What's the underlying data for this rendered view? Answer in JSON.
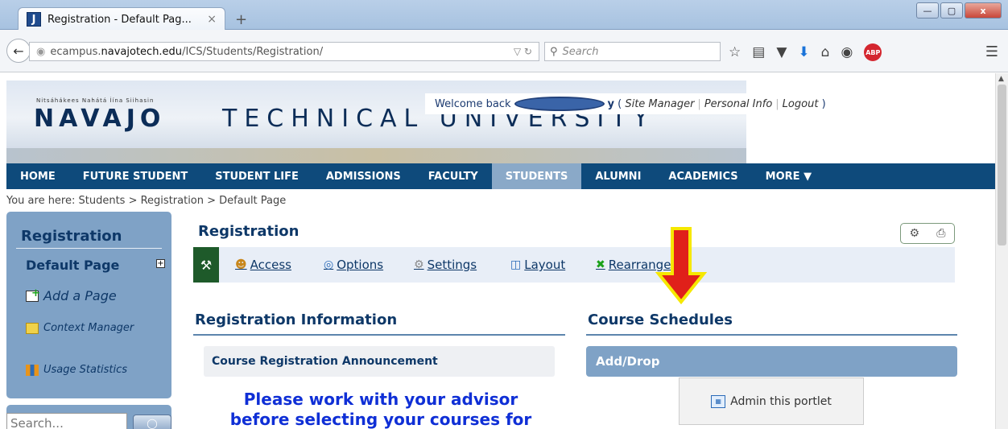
{
  "browser": {
    "tab_title": "Registration - Default Pag...",
    "tab_close": "×",
    "new_tab": "+",
    "url_prefix": "ecampus.",
    "url_domain": "navajotech.edu",
    "url_path": "/ICS/Students/Registration/",
    "search_placeholder": "Search",
    "win_min": "—",
    "win_max": "▢",
    "win_close": "x"
  },
  "banner": {
    "tagline": "Nitsáhákees Nahátá Íína Siihasin",
    "name_left": "NAVAJO",
    "name_right": "TECHNICAL UNIVERSITY"
  },
  "welcome": {
    "prefix": "Welcome back",
    "suffix": "y",
    "role": "Site Manager",
    "personal_info": "Personal Info",
    "logout": "Logout",
    "open_paren": "(",
    "close_paren": ")"
  },
  "topnav": {
    "items": [
      "HOME",
      "FUTURE STUDENT",
      "STUDENT LIFE",
      "ADMISSIONS",
      "FACULTY",
      "STUDENTS",
      "ALUMNI",
      "ACADEMICS",
      "MORE ▼"
    ],
    "active": "STUDENTS"
  },
  "breadcrumb": "You are here:  Students > Registration > Default Page",
  "sidebar": {
    "heading": "Registration",
    "default_page": "Default Page",
    "add_page": "Add a Page",
    "context_manager": "Context Manager",
    "usage_statistics": "Usage Statistics",
    "search_placeholder": "Search...",
    "expand": "+"
  },
  "main": {
    "title": "Registration",
    "admin_links": [
      "Access",
      "Options",
      "Settings",
      "Layout",
      "Rearrange"
    ],
    "col1_heading": "Registration Information",
    "announcement": "Course Registration Announcement",
    "advisor_text_line1": "Please work with your advisor",
    "advisor_text_line2": "before selecting your courses for",
    "col2_heading": "Course Schedules",
    "add_drop": "Add/Drop",
    "admin_portlet": "Admin this portlet"
  },
  "colors": {
    "nav_bg": "#0e4a7b",
    "nav_active": "#8aa9c8",
    "sidebar_bg": "#7fa2c6",
    "heading": "#0e3868",
    "advisor_text": "#0f2fd6",
    "arrow_fill": "#e0201a",
    "arrow_outline": "#f6e800"
  }
}
